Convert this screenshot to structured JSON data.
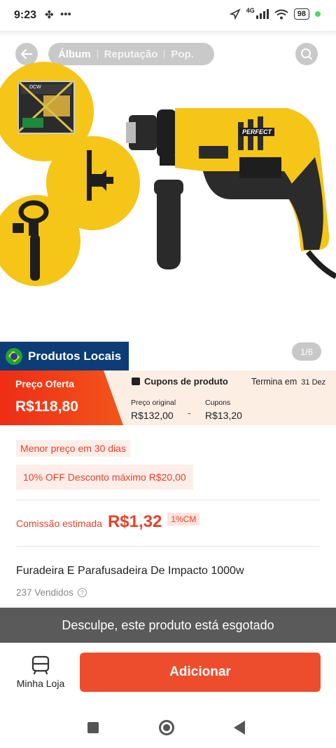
{
  "status_bar": {
    "time": "9:23",
    "network": "4G",
    "battery": "98"
  },
  "gallery": {
    "tabs": [
      "Álbum",
      "Reputação",
      "Pop."
    ],
    "pager": "1/6",
    "badge": "Produtos Locais",
    "product_brand": "PERFECT",
    "box_text": "DCW"
  },
  "price": {
    "offer_label": "Preço Oferta",
    "offer_value": "R$118,80",
    "coupons_title": "Cupons de produto",
    "expires_label": "Termina em",
    "expires_date": "31 Dez",
    "original_label": "Preço original",
    "original_value": "R$132,00",
    "minus": "-",
    "coupons_label": "Cupons",
    "coupons_value": "R$13,20"
  },
  "details": {
    "lowest_price": "Menor preço em 30 dias",
    "discount": "10% OFF Desconto máximo R$20,00",
    "commission_label": "Comissão estimada",
    "commission_value": "R$1,32",
    "commission_badge": "1%CM",
    "title": "Furadeira E Parafusadeira De Impacto 1000w",
    "sold": "237 Vendidos",
    "help": "?"
  },
  "sold_out": "Desculpe, este produto está esgotado",
  "action_bar": {
    "store_label": "Minha Loja",
    "add_label": "Adicionar"
  },
  "colors": {
    "accent": "#ee4d2d",
    "yellow": "#f5c518",
    "badge_blue": "#0d3c77"
  }
}
